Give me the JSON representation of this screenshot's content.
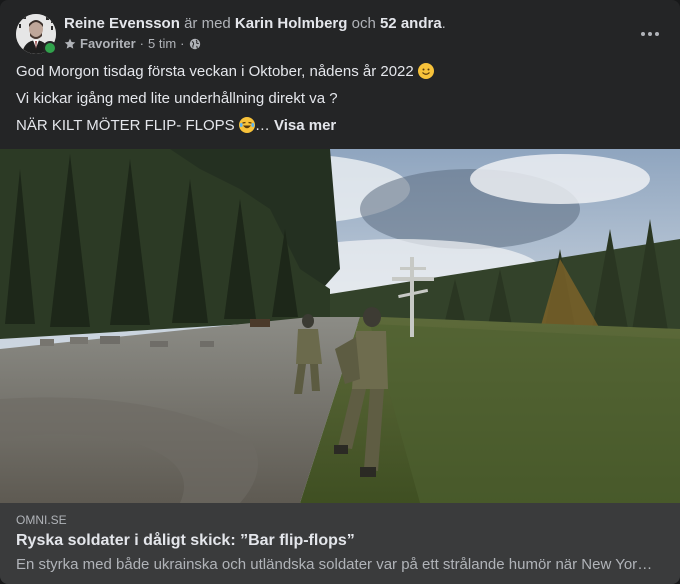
{
  "post": {
    "author": "Reine Evensson",
    "with_text": "är med",
    "tagged_person": "Karin Holmberg",
    "and_text": "och",
    "others": "52 andra",
    "period": ".",
    "audience_label": "Favoriter",
    "separator": "·",
    "timestamp": "5 tim",
    "more_icon": "more-horizontal-icon",
    "star_icon": "star-icon",
    "globe_icon": "globe-icon",
    "online_color": "#31a24c"
  },
  "body": {
    "line1": "God Morgon tisdag första veckan i Oktober, nådens år 2022",
    "line2": "Vi kickar igång med lite underhållning direkt va ?",
    "line3": "NÄR KILT MÖTER FLIP- FLOPS",
    "ellipsis": "…",
    "see_more": "Visa mer"
  },
  "link_card": {
    "domain": "OMNI.SE",
    "title": "Ryska soldater i dåligt skick: ”Bar flip-flops”",
    "description": "En styrka med både ukrainska och utländska soldater var på ett strålande humör när New York Times…"
  },
  "colors": {
    "card_bg": "#242526",
    "link_bg": "#3a3b3c",
    "text_primary": "#e4e6eb",
    "text_secondary": "#b0b3b8"
  }
}
